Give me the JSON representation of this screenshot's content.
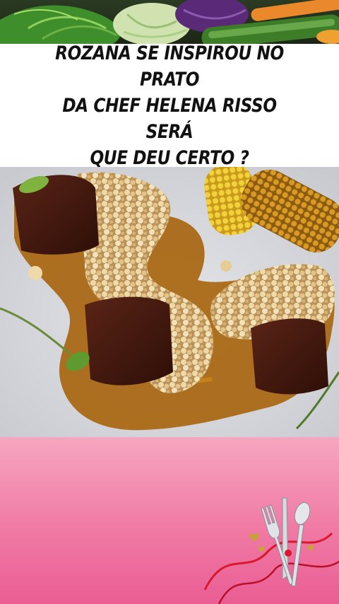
{
  "headline": {
    "line1": "ROZANA SE INSPIROU NO PRATO",
    "line2": "DA CHEF HELENA RISSO SERÁ",
    "line3": "QUE DEU CERTO ?"
  },
  "colors": {
    "headline_text": "#111111",
    "footer_top": "#f6a6c0",
    "footer_bottom": "#ea5d93",
    "ribbon": "#d8182e"
  },
  "icons": {
    "banner": "vegetables-banner",
    "decoration": "fork-knife-spoon-ribbon"
  }
}
